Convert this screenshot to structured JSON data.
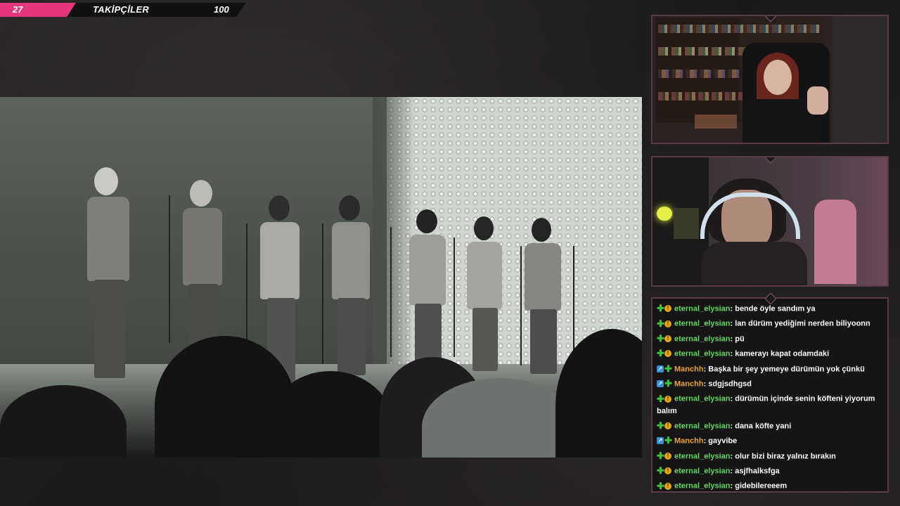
{
  "goal": {
    "current": "27",
    "label": "TAKİPÇİLER",
    "target": "100",
    "progress_fraction": 0.27,
    "color": "#e5367c"
  },
  "chat": {
    "messages": [
      {
        "user": "eternal_elysian",
        "color": "#5cd65c",
        "badges": [
          "plus",
          "coin"
        ],
        "text": ": bende öyle sandım ya"
      },
      {
        "user": "eternal_elysian",
        "color": "#5cd65c",
        "badges": [
          "plus",
          "coin"
        ],
        "text": ": lan dürüm yediğimi nerden biliyoonn"
      },
      {
        "user": "eternal_elysian",
        "color": "#5cd65c",
        "badges": [
          "plus",
          "coin"
        ],
        "text": ": pü"
      },
      {
        "user": "eternal_elysian",
        "color": "#5cd65c",
        "badges": [
          "plus",
          "coin"
        ],
        "text": ": kamerayı kapat odamdaki"
      },
      {
        "user": "Manchh",
        "color": "#e6a23c",
        "badges": [
          "arrow",
          "plus"
        ],
        "text": ": Başka bir şey yemeye dürümün yok çünkü"
      },
      {
        "user": "Manchh",
        "color": "#e6a23c",
        "badges": [
          "arrow",
          "plus"
        ],
        "text": ": sdgjsdhgsd"
      },
      {
        "user": "eternal_elysian",
        "color": "#5cd65c",
        "badges": [
          "plus",
          "coin"
        ],
        "text": ": dürümün içinde senin köfteni yiyorum balım"
      },
      {
        "user": "eternal_elysian",
        "color": "#5cd65c",
        "badges": [
          "plus",
          "coin"
        ],
        "text": ": dana köfte yani"
      },
      {
        "user": "Manchh",
        "color": "#e6a23c",
        "badges": [
          "arrow",
          "plus"
        ],
        "text": ": gayvibe"
      },
      {
        "user": "eternal_elysian",
        "color": "#5cd65c",
        "badges": [
          "plus",
          "coin"
        ],
        "text": ": olur bizi biraz yalnız bırakın"
      },
      {
        "user": "eternal_elysian",
        "color": "#5cd65c",
        "badges": [
          "plus",
          "coin"
        ],
        "text": ": asjfhalksfga"
      },
      {
        "user": "eternal_elysian",
        "color": "#5cd65c",
        "badges": [
          "plus",
          "coin"
        ],
        "text": ": gidebilereeem"
      }
    ]
  },
  "icons": {
    "plus": "plus-badge-icon",
    "coin": "coin-badge-icon",
    "arrow": "arrow-badge-icon"
  },
  "accent": "#5a3a46"
}
